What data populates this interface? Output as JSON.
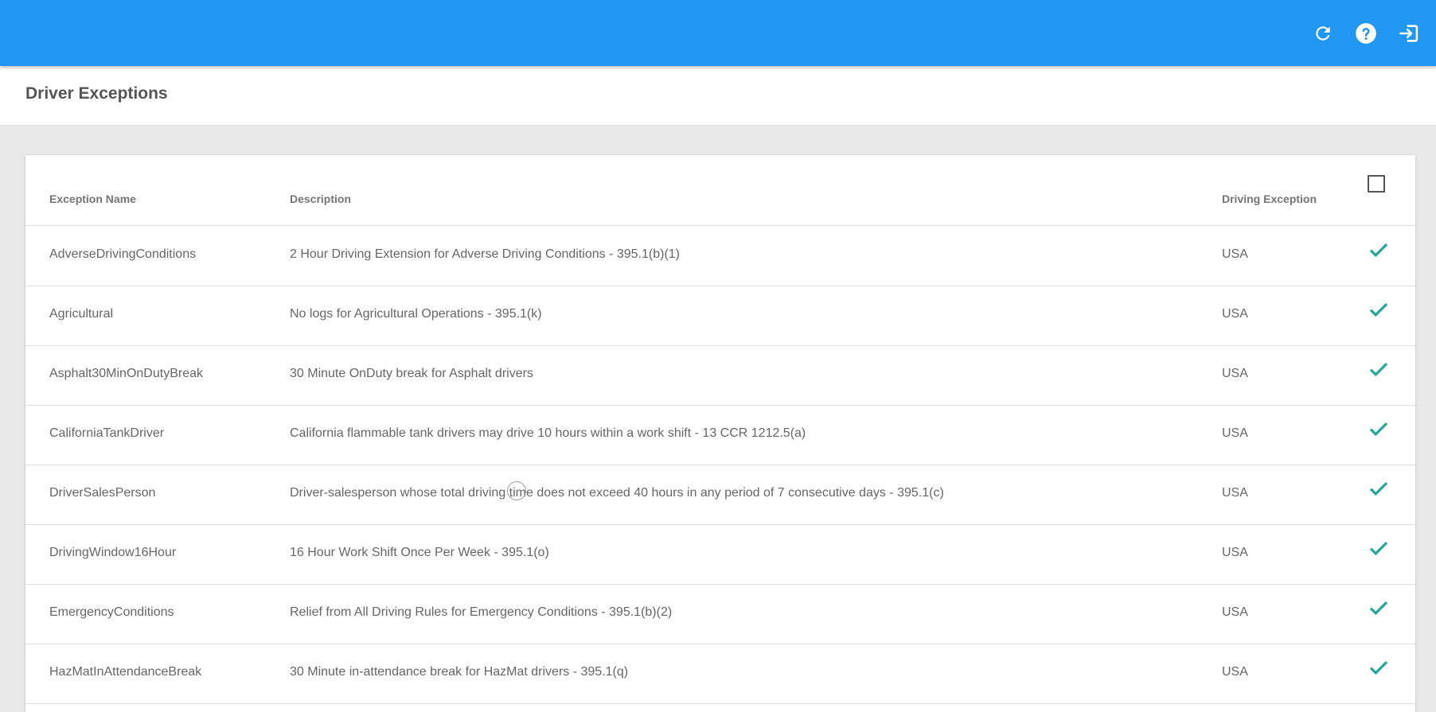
{
  "header": {
    "icons": [
      "refresh-icon",
      "help-icon",
      "logout-icon"
    ],
    "bar_color": "#2196f3"
  },
  "page": {
    "title": "Driver Exceptions"
  },
  "table": {
    "columns": {
      "name": "Exception Name",
      "description": "Description",
      "driving_exception": "Driving Exception"
    },
    "check_color": "#26a69a",
    "rows": [
      {
        "name": "AdverseDrivingConditions",
        "description": "2 Hour Driving Extension for Adverse Driving Conditions - 395.1(b)(1)",
        "driving_exception": "USA",
        "checked": true
      },
      {
        "name": "Agricultural",
        "description": "No logs for Agricultural Operations - 395.1(k)",
        "driving_exception": "USA",
        "checked": true
      },
      {
        "name": "Asphalt30MinOnDutyBreak",
        "description": "30 Minute OnDuty break for Asphalt drivers",
        "driving_exception": "USA",
        "checked": true
      },
      {
        "name": "CaliforniaTankDriver",
        "description": "California flammable tank drivers may drive 10 hours within a work shift - 13 CCR 1212.5(a)",
        "driving_exception": "USA",
        "checked": true
      },
      {
        "name": "DriverSalesPerson",
        "description": "Driver-salesperson whose total driving time does not exceed 40 hours in any period of 7 consecutive days - 395.1(c)",
        "driving_exception": "USA",
        "checked": true
      },
      {
        "name": "DrivingWindow16Hour",
        "description": "16 Hour Work Shift Once Per Week - 395.1(o)",
        "driving_exception": "USA",
        "checked": true
      },
      {
        "name": "EmergencyConditions",
        "description": "Relief from All Driving Rules for Emergency Conditions - 395.1(b)(2)",
        "driving_exception": "USA",
        "checked": true
      },
      {
        "name": "HazMatInAttendanceBreak",
        "description": "30 Minute in-attendance break for HazMat drivers - 395.1(q)",
        "driving_exception": "USA",
        "checked": true
      }
    ]
  }
}
